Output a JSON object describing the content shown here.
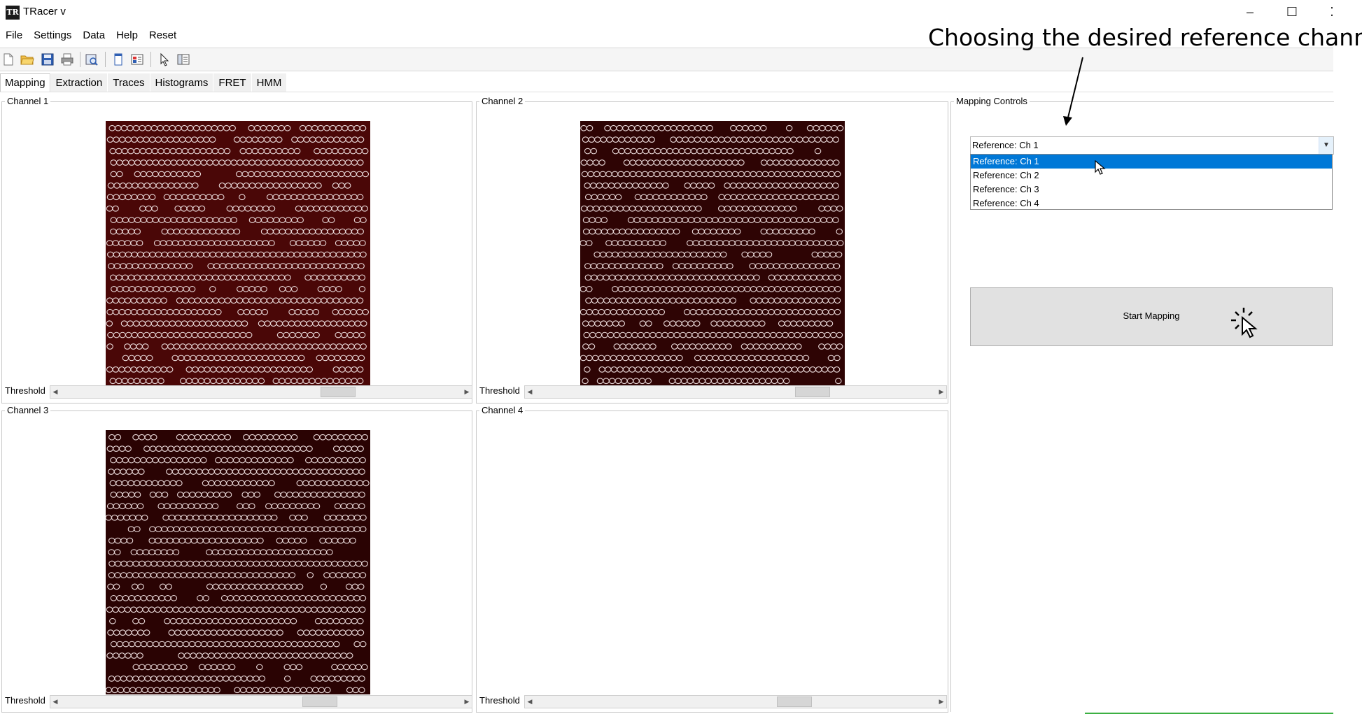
{
  "window": {
    "title": "TRacer v",
    "app_icon_text": "TR",
    "controls": {
      "minimize": "–",
      "maximize": "☐",
      "close": "⁚"
    }
  },
  "menu": [
    "File",
    "Settings",
    "Data",
    "Help",
    "Reset"
  ],
  "toolbar_icons": [
    "new-file-icon",
    "open-folder-icon",
    "save-icon",
    "print-icon",
    "print-preview-icon",
    "panel-icon",
    "layout-icon",
    "pointer-icon",
    "sidebar-icon"
  ],
  "tabs": [
    {
      "label": "Mapping",
      "active": true
    },
    {
      "label": "Extraction",
      "active": false
    },
    {
      "label": "Traces",
      "active": false
    },
    {
      "label": "Histograms",
      "active": false
    },
    {
      "label": "FRET",
      "active": false
    },
    {
      "label": "HMM",
      "active": false
    }
  ],
  "channels": [
    {
      "title": "Channel 1",
      "threshold_label": "Threshold",
      "has_image": true,
      "threshold_position": 0.71
    },
    {
      "title": "Channel 2",
      "threshold_label": "Threshold",
      "has_image": true,
      "threshold_position": 0.71
    },
    {
      "title": "Channel 3",
      "threshold_label": "Threshold",
      "has_image": true,
      "threshold_position": 0.66
    },
    {
      "title": "Channel 4",
      "threshold_label": "Threshold",
      "has_image": false,
      "threshold_position": 0.66
    }
  ],
  "mapping_controls": {
    "title": "Mapping Controls",
    "reference_selected": "Reference: Ch 1",
    "reference_options": [
      "Reference: Ch 1",
      "Reference: Ch 2",
      "Reference: Ch 3",
      "Reference: Ch 4"
    ],
    "start_button": "Start Mapping"
  },
  "annotation": "Choosing the desired reference channel",
  "colors": {
    "image_bg": "#3a0505",
    "spot_ring": "#e8d8d8",
    "selection": "#0078d7",
    "status_bar": "#3cb043"
  }
}
